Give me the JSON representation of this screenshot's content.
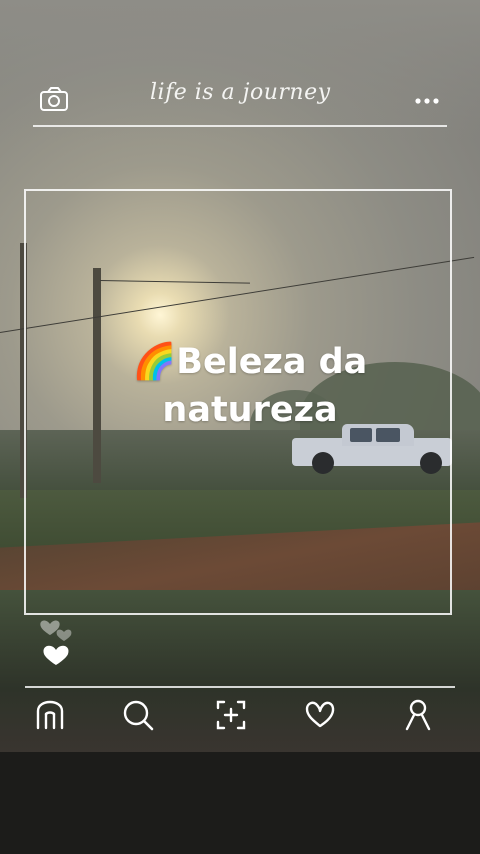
{
  "header": {
    "title": "life is a journey",
    "left_icon": "camera-icon",
    "right_icon": "more-horizontal-icon"
  },
  "post": {
    "caption_emoji": "🌈",
    "caption_line1": "Beleza da",
    "caption_line2": "natureza"
  },
  "reactions": {
    "icon": "hearts-icon"
  },
  "bottom_nav": {
    "items": [
      {
        "icon": "home-icon"
      },
      {
        "icon": "search-icon"
      },
      {
        "icon": "add-post-icon"
      },
      {
        "icon": "heart-icon"
      },
      {
        "icon": "profile-icon"
      }
    ]
  },
  "colors": {
    "overlay_line": "#ffffff",
    "caption_text": "#ffffff",
    "bottom_bar": "#1c1c1a"
  }
}
